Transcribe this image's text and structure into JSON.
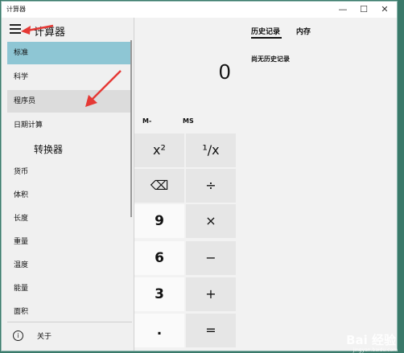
{
  "window": {
    "title": "计算器",
    "minimize": "—",
    "maximize": "☐",
    "close": "✕"
  },
  "nav": {
    "title": "计算器",
    "calculator_items": [
      {
        "label": "标准",
        "state": "selected"
      },
      {
        "label": "科学",
        "state": "normal"
      },
      {
        "label": "程序员",
        "state": "hover"
      },
      {
        "label": "日期计算",
        "state": "normal"
      }
    ],
    "converter_section": "转换器",
    "converter_items": [
      {
        "label": "货币"
      },
      {
        "label": "体积"
      },
      {
        "label": "长度"
      },
      {
        "label": "重量"
      },
      {
        "label": "温度"
      },
      {
        "label": "能量"
      },
      {
        "label": "面积"
      }
    ],
    "about_icon": "i",
    "about_label": "关于"
  },
  "side_panel": {
    "tab_history": "历史记录",
    "tab_memory": "内存",
    "empty_message": "尚无历史记录"
  },
  "display": {
    "value": "0"
  },
  "memory_buttons": {
    "m_minus": "M-",
    "ms": "MS"
  },
  "keypad": {
    "square": "x²",
    "reciprocal": "¹/x",
    "backspace": "⌫",
    "divide": "÷",
    "nine": "9",
    "multiply": "×",
    "six": "6",
    "minus": "−",
    "three": "3",
    "plus": "+",
    "decimal": ".",
    "equals": "="
  },
  "watermark": {
    "text": "Bai 经验",
    "sub": "jingyan.baidu.com"
  },
  "colors": {
    "selected_item": "#8ec6d4",
    "arrow": "#e53935"
  }
}
